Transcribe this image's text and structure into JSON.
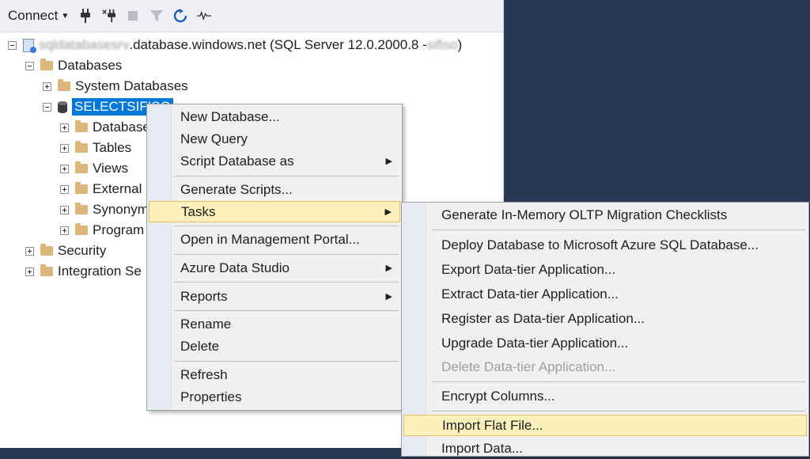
{
  "toolbar": {
    "connect_label": "Connect",
    "icons": [
      "connect-icon",
      "disconnect-icon",
      "stop-icon",
      "filter-icon",
      "refresh-icon",
      "activity-monitor-icon"
    ]
  },
  "tree": {
    "server_name": "sqldatabasesrv",
    "server_suffix": ".database.windows.net (SQL Server 12.0.2000.8 - ",
    "server_user": "sifiso",
    "server_end": ")",
    "databases": "Databases",
    "system_databases": "System Databases",
    "selected_db": "SELECTSIFISO",
    "children": [
      "Database",
      "Tables",
      "Views",
      "External",
      "Synonym",
      "Program"
    ],
    "security": "Security",
    "integration": "Integration Se"
  },
  "context_menu": {
    "new_database": "New Database...",
    "new_query": "New Query",
    "script_database_as": "Script Database as",
    "generate_scripts": "Generate Scripts...",
    "tasks": "Tasks",
    "open_portal": "Open in Management Portal...",
    "azure_data_studio": "Azure Data Studio",
    "reports": "Reports",
    "rename": "Rename",
    "delete": "Delete",
    "refresh": "Refresh",
    "properties": "Properties"
  },
  "tasks_menu": {
    "oltp_checklists": "Generate In-Memory OLTP Migration Checklists",
    "deploy_azure": "Deploy Database to Microsoft Azure SQL Database...",
    "export_dac": "Export Data-tier Application...",
    "extract_dac": "Extract Data-tier Application...",
    "register_dac": "Register as Data-tier Application...",
    "upgrade_dac": "Upgrade Data-tier Application...",
    "delete_dac": "Delete Data-tier Application...",
    "encrypt_columns": "Encrypt Columns...",
    "import_flat_file": "Import Flat File...",
    "import_data": "Import Data..."
  },
  "colors": {
    "background": "#293955",
    "selection": "#0078d7",
    "menu_highlight": "#fcf1bd"
  }
}
